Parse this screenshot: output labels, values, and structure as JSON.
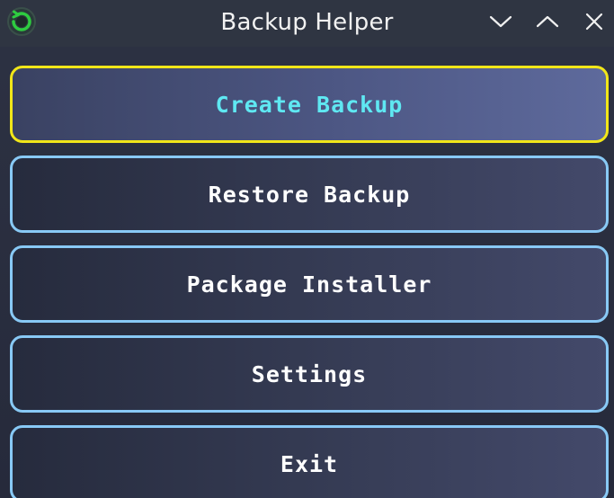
{
  "window": {
    "title": "Backup Helper",
    "controls": {
      "minimize_icon": "chevron-down-icon",
      "maximize_icon": "chevron-up-icon",
      "close_icon": "close-icon"
    },
    "app_icon": "refresh-circle-icon"
  },
  "menu": {
    "items": [
      {
        "label": "Create Backup",
        "active": true
      },
      {
        "label": "Restore Backup",
        "active": false
      },
      {
        "label": "Package Installer",
        "active": false
      },
      {
        "label": "Settings",
        "active": false
      },
      {
        "label": "Exit",
        "active": false
      }
    ]
  },
  "colors": {
    "border_default": "#88c9f5",
    "border_active": "#f1e619",
    "label_active": "#5fe8f2",
    "label_default": "#ffffff",
    "app_icon_accent": "#2ecc40"
  }
}
